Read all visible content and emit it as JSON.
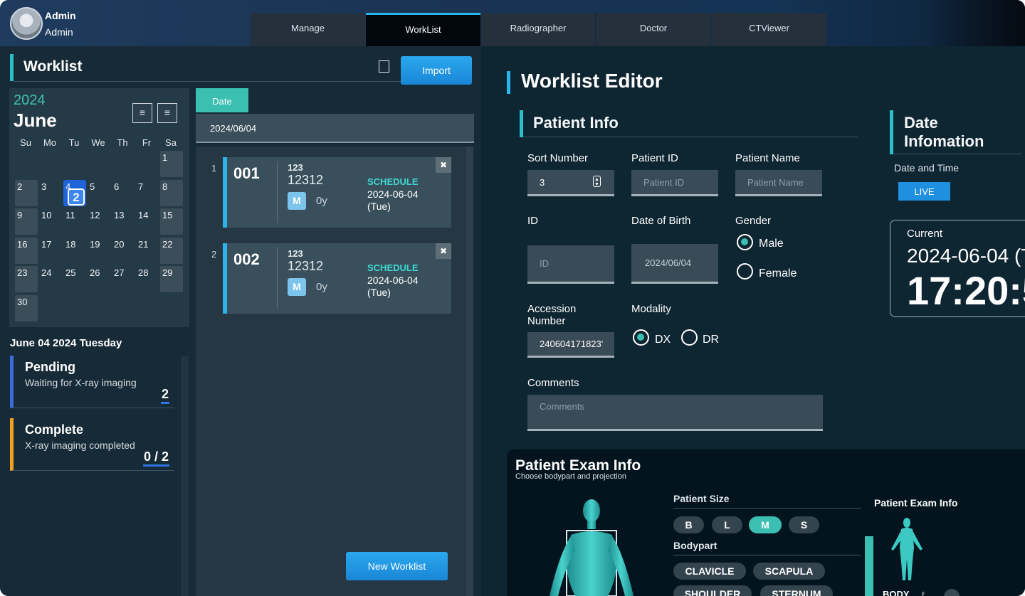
{
  "user": {
    "name": "Admin",
    "role": "Admin"
  },
  "nav": {
    "tabs": [
      "Manage",
      "WorkList",
      "Radiographer",
      "Doctor",
      "CTViewer"
    ],
    "active": "WorkList"
  },
  "worklist": {
    "title": "Worklist",
    "import_label": "Import"
  },
  "calendar": {
    "year": "2024",
    "month": "June",
    "weekdays": [
      "Su",
      "Mo",
      "Tu",
      "We",
      "Th",
      "Fr",
      "Sa"
    ],
    "days": [
      "1",
      "2",
      "3",
      "4",
      "5",
      "6",
      "7",
      "8",
      "9",
      "10",
      "11",
      "12",
      "13",
      "14",
      "15",
      "16",
      "17",
      "18",
      "19",
      "20",
      "21",
      "22",
      "23",
      "24",
      "25",
      "26",
      "27",
      "28",
      "29",
      "30"
    ],
    "today_count": "2"
  },
  "selected_date_label": "June 04 2024 Tuesday",
  "status": {
    "pending": {
      "title": "Pending",
      "subtitle": "Waiting for X-ray imaging",
      "count": "2"
    },
    "complete": {
      "title": "Complete",
      "subtitle": "X-ray imaging completed",
      "count": "0 / 2"
    }
  },
  "list": {
    "tab_label": "Date",
    "date_value": "2024/06/04",
    "items": [
      {
        "index": "1",
        "number": "001",
        "patient_id": "123",
        "patient_name": "12312",
        "sex": "M",
        "age": "0y",
        "status": "SCHEDULE",
        "date": "2024-06-04",
        "weekday": "(Tue)"
      },
      {
        "index": "2",
        "number": "002",
        "patient_id": "123",
        "patient_name": "12312",
        "sex": "M",
        "age": "0y",
        "status": "SCHEDULE",
        "date": "2024-06-04",
        "weekday": "(Tue)"
      }
    ],
    "new_label": "New Worklist"
  },
  "editor": {
    "title": "Worklist Editor",
    "patient_info": "Patient Info",
    "sort_number_label": "Sort Number",
    "sort_number_value": "3",
    "patient_id_label": "Patient ID",
    "patient_id_placeholder": "Patient ID",
    "patient_name_label": "Patient Name",
    "patient_name_placeholder": "Patient Name",
    "id_label": "ID",
    "id_placeholder": "ID",
    "dob_label": "Date of Birth",
    "dob_value": "2024/06/04",
    "gender_label": "Gender",
    "gender_options": [
      "Male",
      "Female"
    ],
    "gender_selected": "Male",
    "accession_label": "Accession Number",
    "accession_value": "240604171823'",
    "modality_label": "Modality",
    "modality_options": [
      "DX",
      "DR"
    ],
    "modality_selected": "DX",
    "comments_label": "Comments",
    "comments_placeholder": "Comments"
  },
  "date_info": {
    "title": "Date Infomation",
    "datetime_label": "Date and Time",
    "live_label": "LIVE",
    "current_label": "Current",
    "current_date": "2024-06-04 (T",
    "current_time": "17:20:5"
  },
  "exam": {
    "title": "Patient Exam Info",
    "subtitle": "Choose bodypart and projection",
    "size_label": "Patient Size",
    "sizes": [
      "B",
      "L",
      "M",
      "S"
    ],
    "size_selected": "M",
    "bodypart_label": "Bodypart",
    "bodyparts": [
      "CLAVICLE",
      "SCAPULA",
      "SHOULDER",
      "STERNUM"
    ],
    "side_title": "Patient Exam Info",
    "body_label": "BODY"
  },
  "colors": {
    "accent": "#2ab4e9",
    "teal": "#3bbfb0",
    "pending": "#3c6bdc",
    "complete": "#f0a020"
  }
}
